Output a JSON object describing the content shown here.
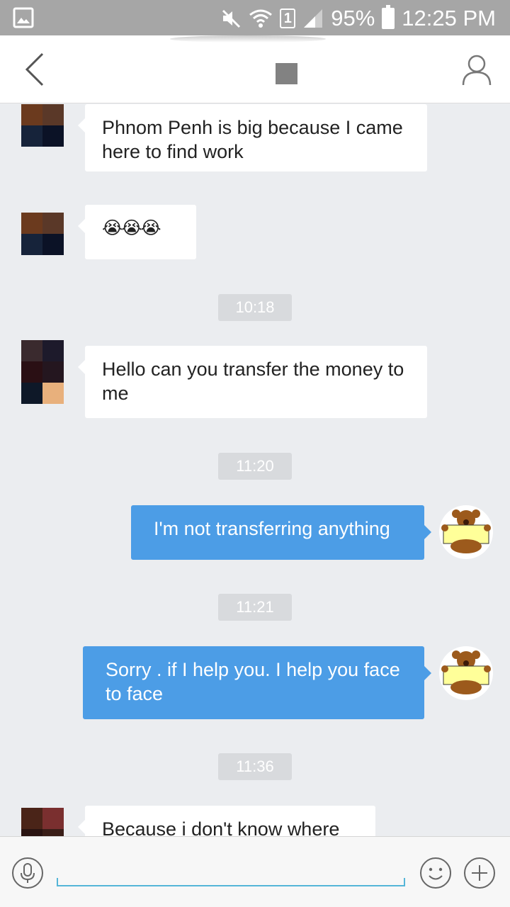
{
  "status_bar": {
    "sim_slot": "1",
    "battery": "95%",
    "time": "12:25 PM",
    "icons": [
      "gallery-icon",
      "mute-icon",
      "wifi-icon",
      "sim-icon",
      "signal-icon",
      "battery-icon"
    ]
  },
  "header": {
    "back_icon": "chevron-left-icon",
    "profile_icon": "person-icon"
  },
  "messages": [
    {
      "direction": "in",
      "text": "Phnom Penh is big because I came here to find work"
    },
    {
      "direction": "in",
      "text": "😭😭😭"
    },
    {
      "type": "time",
      "text": "10:18"
    },
    {
      "direction": "in",
      "text": "Hello can you transfer the money to me"
    },
    {
      "type": "time",
      "text": "11:20"
    },
    {
      "direction": "out",
      "text": "I'm not transferring anything"
    },
    {
      "type": "time",
      "text": "11:21"
    },
    {
      "direction": "out",
      "text": "Sorry . if I help you. I help you face to face"
    },
    {
      "type": "time",
      "text": "11:36"
    },
    {
      "direction": "in",
      "text": "Because i don't know where"
    }
  ],
  "input_bar": {
    "value": "",
    "icons": [
      "mic-icon",
      "smiley-icon",
      "plus-icon"
    ]
  },
  "colors": {
    "status_bar": "#a6a6a6",
    "chat_background": "#ebedf0",
    "outgoing_bubble": "#4c9de6",
    "incoming_bubble": "#ffffff",
    "timestamp_pill": "#d8dadd",
    "input_underline": "#55b5d8"
  }
}
